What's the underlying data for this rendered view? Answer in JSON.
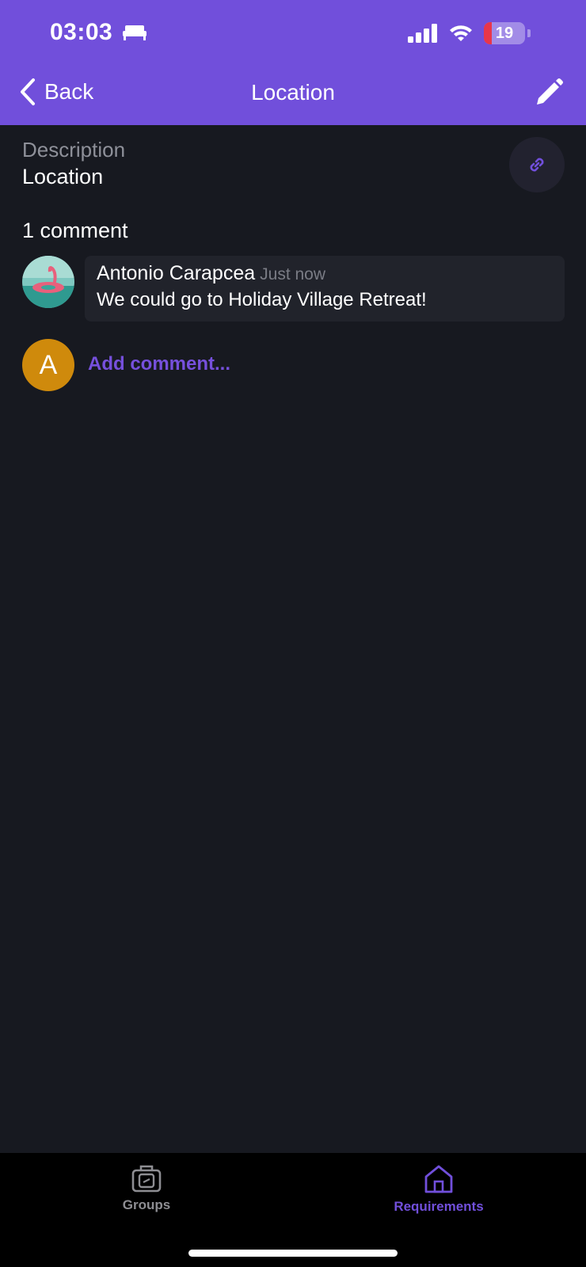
{
  "status_bar": {
    "time": "03:03",
    "battery_level": "19"
  },
  "nav": {
    "back_label": "Back",
    "title": "Location"
  },
  "details": {
    "description_label": "Description",
    "description_value": "Location"
  },
  "comments": {
    "count_label": "1 comment",
    "items": [
      {
        "author": "Antonio Carapcea",
        "time": "Just now",
        "text": "We could go to Holiday Village Retreat!"
      }
    ],
    "current_user_initial": "A",
    "add_placeholder": "Add comment..."
  },
  "tabbar": {
    "items": [
      {
        "label": "Groups",
        "icon": "luggage-icon",
        "active": false
      },
      {
        "label": "Requirements",
        "icon": "home-icon",
        "active": true
      }
    ]
  },
  "colors": {
    "accent": "#714fdb",
    "background": "#171920",
    "avatar_orange": "#cf8a0c"
  }
}
